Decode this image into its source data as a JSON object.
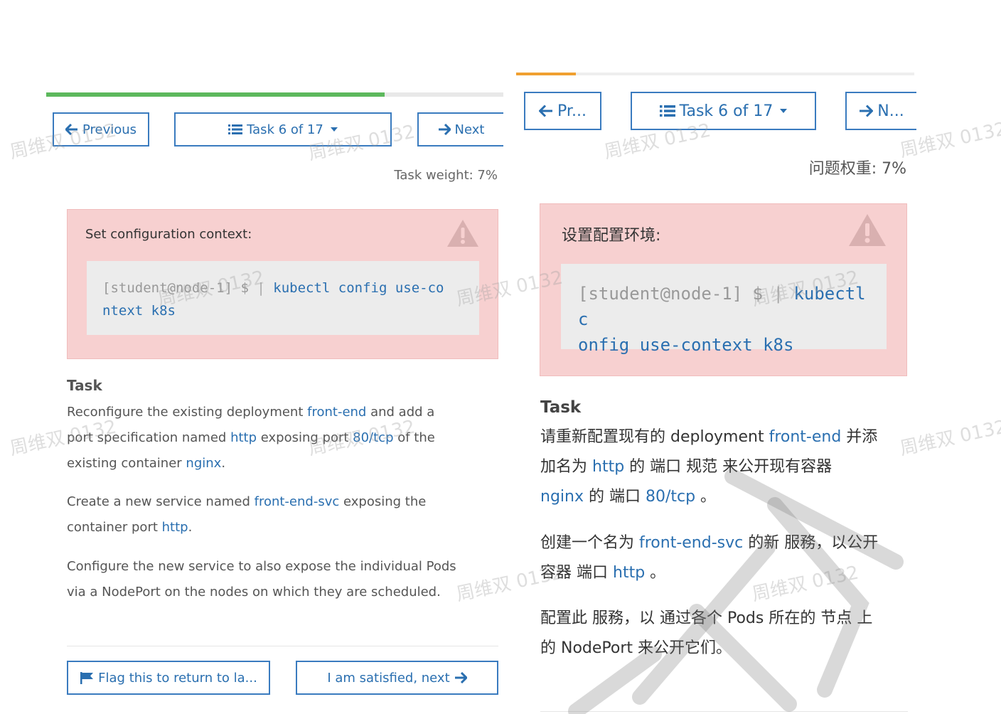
{
  "left": {
    "progress_percent": 74,
    "nav": {
      "previous_label": "Previous",
      "task_label": "Task 6 of 17",
      "next_label": "Next"
    },
    "task_weight": "Task weight: 7%",
    "alert": {
      "title": "Set configuration context:",
      "prompt": "[student@node-1] $",
      "command_line1": "kubectl config use-co",
      "command_line2": "ntext k8s"
    },
    "task_heading": "Task",
    "p1": {
      "a": "Reconfigure the existing deployment ",
      "b": "front-end",
      "c": " and add a",
      "d": "port specification named ",
      "e": "http",
      "f": " exposing port ",
      "g": "80/tcp",
      "h": " of the",
      "i": "existing container ",
      "j": "nginx",
      "k": "."
    },
    "p2": {
      "a": "Create a new service named ",
      "b": "front-end-svc",
      "c": " exposing the",
      "d": "container port ",
      "e": "http",
      "f": "."
    },
    "p3": {
      "line1": "Configure the new service to also expose the individual Pods",
      "line2": "via a NodePort on the nodes on which they are scheduled."
    },
    "footer": {
      "flag_label": "Flag this to return to la...",
      "satisfied_label": "I am satisfied, next"
    }
  },
  "right": {
    "progress_percent": 15,
    "nav": {
      "previous_label": "Pr...",
      "task_label": "Task 6 of 17",
      "next_label": "N..."
    },
    "task_weight": "问题权重: 7%",
    "alert": {
      "title": "设置配置环境:",
      "prompt": "[student@node-1] $",
      "command_line1": "kubectl c",
      "command_line2": "onfig use-context k8s"
    },
    "task_heading": "Task",
    "p1": {
      "a": "请重新配置现有的 deployment ",
      "b": "front-end",
      "c": " 并添",
      "d": "加名为 ",
      "e": "http",
      "f": " 的 端口 规范 来公开现有容器",
      "g": "nginx",
      "h": " 的 端口 ",
      "i": "80/tcp",
      "j": " 。"
    },
    "p2": {
      "a": "创建一个名为 ",
      "b": "front-end-svc",
      "c": " 的新 服務，以公开",
      "d": "容器 端口 ",
      "e": "http",
      "f": " 。"
    },
    "p3": {
      "line1": "配置此 服務，以 通过各个 Pods 所在的 节点 上",
      "line2": "的 NodePort 来公开它们。"
    }
  },
  "watermarks": [
    "周维双 0132",
    "周维双 0132",
    "周维双 0132",
    "周维双 0132",
    "周维双 0132",
    "周维双 0132",
    "周维双 0132",
    "周维双 0132",
    "周维双 0132",
    "周维双 0132",
    "周维双 0132",
    "周维双 0132"
  ],
  "colors": {
    "accent_blue": "#2a6fb0",
    "progress_green": "#5cb85c",
    "progress_orange": "#f0a030",
    "alert_bg": "#f7d0d0",
    "code_bg": "#ececec"
  }
}
